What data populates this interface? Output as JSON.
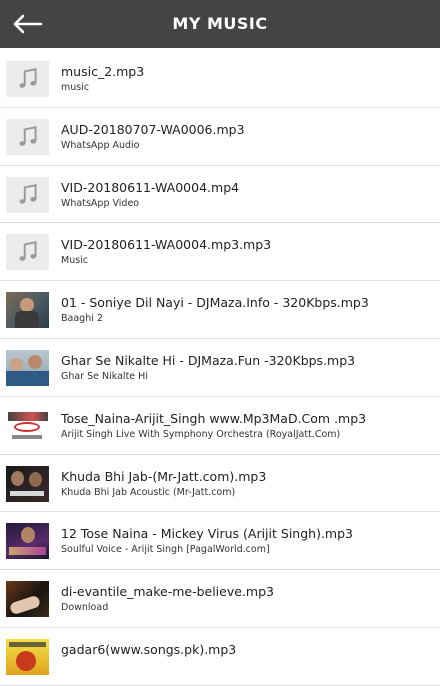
{
  "header": {
    "title": "MY MUSIC",
    "back_icon": "arrow-left-icon",
    "background": "#444444"
  },
  "songs": [
    {
      "title": "music_2.mp3",
      "album": "music",
      "thumb": "music-note"
    },
    {
      "title": "AUD-20180707-WA0006.mp3",
      "album": "WhatsApp Audio",
      "thumb": "music-note"
    },
    {
      "title": "VID-20180611-WA0004.mp4",
      "album": "WhatsApp Video",
      "thumb": "music-note"
    },
    {
      "title": "VID-20180611-WA0004.mp3.mp3",
      "album": "Music",
      "thumb": "music-note"
    },
    {
      "title": "01 - Soniye Dil Nayi - DJMaza.Info - 320Kbps.mp3",
      "album": "Baaghi 2",
      "thumb": "album-art"
    },
    {
      "title": "Ghar Se Nikalte Hi - DJMaza.Fun -320Kbps.mp3",
      "album": "Ghar Se Nikalte Hi",
      "thumb": "album-art"
    },
    {
      "title": "Tose_Naina-Arijit_Singh www.Mp3MaD.Com .mp3",
      "album": "Arijit Singh Live With Symphony Orchestra (RoyalJatt.Com)",
      "thumb": "album-art"
    },
    {
      "title": "Khuda Bhi Jab-(Mr-Jatt.com).mp3",
      "album": "Khuda Bhi Jab Acoustic (Mr-Jatt.com)",
      "thumb": "album-art"
    },
    {
      "title": "12 Tose Naina - Mickey Virus (Arijit Singh).mp3",
      "album": "Soulful Voice - Arijit Singh [PagalWorld.com]",
      "thumb": "album-art"
    },
    {
      "title": "di-evantile_make-me-believe.mp3",
      "album": "Download",
      "thumb": "album-art"
    },
    {
      "title": "gadar6(www.songs.pk).mp3",
      "album": "",
      "thumb": "album-art"
    }
  ]
}
